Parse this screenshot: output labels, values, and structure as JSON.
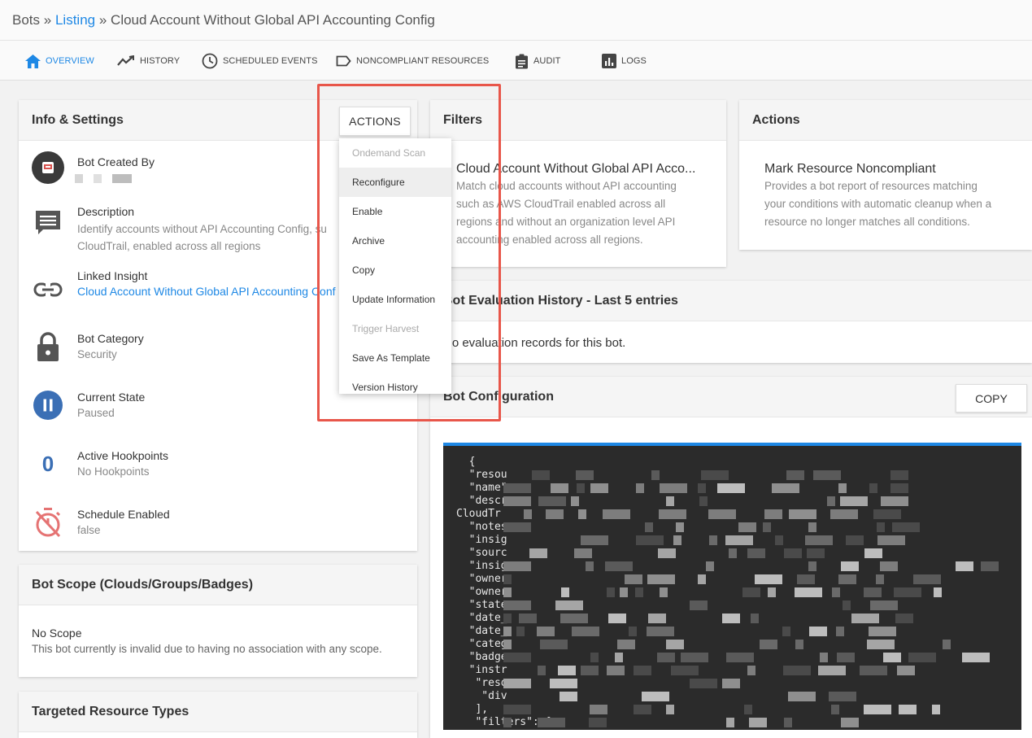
{
  "breadcrumb": {
    "root": "Bots",
    "sep1": "»",
    "listing": "Listing",
    "sep2": "»",
    "current": "Cloud Account Without Global API Accounting Config"
  },
  "tabs": [
    {
      "label": "OVERVIEW",
      "icon": "home-icon",
      "active": true
    },
    {
      "label": "HISTORY",
      "icon": "trend-icon",
      "active": false
    },
    {
      "label": "SCHEDULED EVENTS",
      "icon": "clock-icon",
      "active": false
    },
    {
      "label": "NONCOMPLIANT RESOURCES",
      "icon": "label-icon",
      "active": false
    },
    {
      "label": "AUDIT",
      "icon": "clipboard-icon",
      "active": false
    },
    {
      "label": "LOGS",
      "icon": "bar-chart-icon",
      "active": false
    }
  ],
  "info": {
    "title": "Info & Settings",
    "actions_label": "ACTIONS",
    "created_by_label": "Bot Created By",
    "description_label": "Description",
    "description_line1": "Identify accounts without API Accounting Config, su",
    "description_line2": "CloudTrail, enabled across all regions",
    "linked_insight_label": "Linked Insight",
    "linked_insight_value": "Cloud Account Without Global API Accounting Conf",
    "category_label": "Bot Category",
    "category_value": "Security",
    "state_label": "Current State",
    "state_value": "Paused",
    "hookpoints_label": "Active Hookpoints",
    "hookpoints_count": "0",
    "hookpoints_value": "No Hookpoints",
    "schedule_label": "Schedule Enabled",
    "schedule_value": "false"
  },
  "actions_menu": [
    {
      "label": "Ondemand Scan",
      "disabled": true
    },
    {
      "label": "Reconfigure",
      "disabled": false,
      "hover": true
    },
    {
      "label": "Enable",
      "disabled": false
    },
    {
      "label": "Archive",
      "disabled": false
    },
    {
      "label": "Copy",
      "disabled": false
    },
    {
      "label": "Update Information",
      "disabled": false
    },
    {
      "label": "Trigger Harvest",
      "disabled": true
    },
    {
      "label": "Save As Template",
      "disabled": false
    },
    {
      "label": "Version History",
      "disabled": false
    }
  ],
  "scope": {
    "title": "Bot Scope (Clouds/Groups/Badges)",
    "value": "No Scope",
    "note": "This bot currently is invalid due to having no association with any scope."
  },
  "targeted": {
    "title": "Targeted Resource Types"
  },
  "filters": {
    "title": "Filters",
    "item_title": "Cloud Account Without Global API Acco...",
    "item_desc": [
      "Match cloud accounts without API accounting",
      "such as AWS CloudTrail enabled across all",
      "regions and without an organization level API",
      "accounting enabled across all regions."
    ]
  },
  "actions_card": {
    "title": "Actions",
    "item_title": "Mark Resource Noncompliant",
    "item_desc": [
      "Provides a bot report of resources matching",
      "your conditions with automatic cleanup when a",
      "resource no longer matches all conditions."
    ]
  },
  "evaluation": {
    "title": "Bot Evaluation History - Last 5 entries",
    "empty": "No evaluation records for this bot."
  },
  "config": {
    "title": "Bot Configuration",
    "copy_label": "COPY",
    "lines": [
      "  {",
      "  \"resou",
      "  \"name\"",
      "  \"descr",
      "CloudTr",
      "  \"notes",
      "  \"insig",
      "  \"sourc",
      "  \"insig",
      "  \"owner",
      "  \"owner",
      "  \"state",
      "  \"date_",
      "  \"date_",
      "  \"categ",
      "  \"badge",
      "  \"instr",
      "   \"reso",
      "    \"div",
      "   ],",
      "   \"filters\": ["
    ]
  },
  "colors": {
    "accent": "#1e88e5",
    "highlight": "#e8564a",
    "state_icon": "#3b6fb5",
    "schedule_icon": "#e57373"
  }
}
